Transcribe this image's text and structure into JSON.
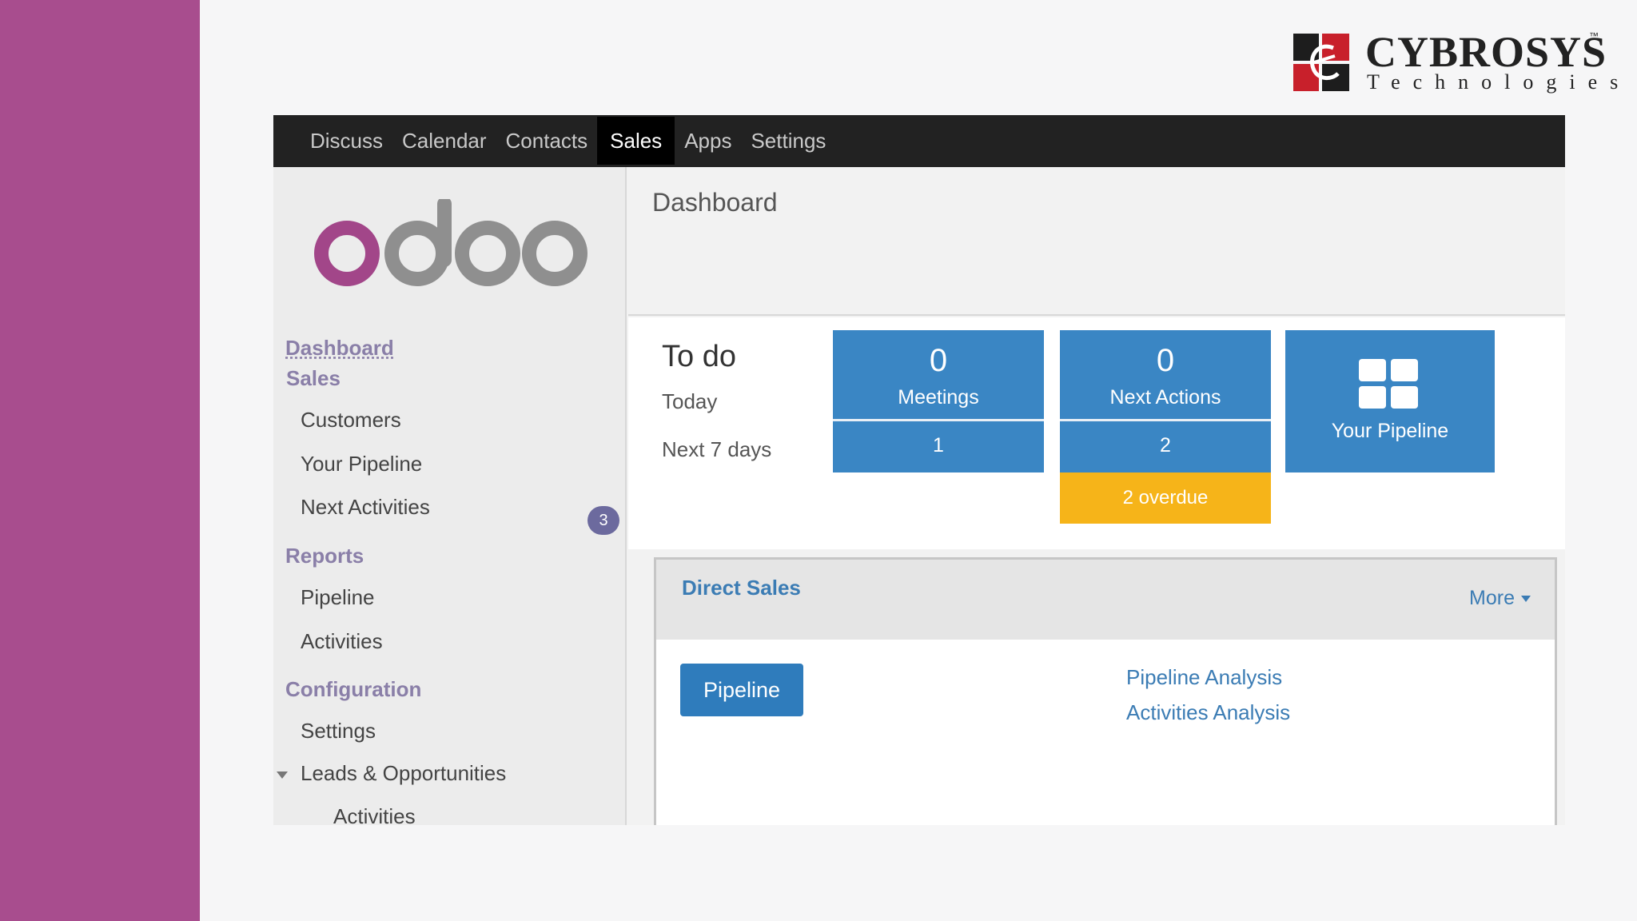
{
  "brand": {
    "name": "CYBROSYS",
    "tm": "™",
    "subtitle": "Technologies"
  },
  "colors": {
    "left_band": "#a84d8e",
    "topbar": "#222222",
    "tile_blue": "#3a86c4",
    "overdue_orange": "#f6b419",
    "link_blue": "#3b7cb4"
  },
  "topbar": {
    "items": [
      "Discuss",
      "Calendar",
      "Contacts",
      "Sales",
      "Apps",
      "Settings"
    ],
    "active": "Sales"
  },
  "sidebar": {
    "logo_text": "odoo",
    "dashboard": "Dashboard",
    "sales_section": "Sales",
    "customers": "Customers",
    "your_pipeline": "Your Pipeline",
    "next_activities": "Next Activities",
    "next_activities_badge": "3",
    "reports_section": "Reports",
    "reports_pipeline": "Pipeline",
    "reports_activities": "Activities",
    "configuration_section": "Configuration",
    "config_settings": "Settings",
    "leads_opportunities": "Leads & Opportunities",
    "leads_activities": "Activities"
  },
  "main": {
    "title": "Dashboard",
    "todo": {
      "title": "To do",
      "today": "Today",
      "next7": "Next 7 days"
    },
    "meetings": {
      "count": "0",
      "label": "Meetings",
      "week": "1"
    },
    "next_actions": {
      "count": "0",
      "label": "Next Actions",
      "week": "2",
      "overdue": "2 overdue"
    },
    "pipeline_tile": {
      "label": "Your Pipeline",
      "icon": "grid-icon"
    },
    "team": {
      "name": "Direct Sales",
      "more": "More",
      "pipeline_button": "Pipeline",
      "links": [
        "Pipeline Analysis",
        "Activities Analysis"
      ]
    }
  }
}
